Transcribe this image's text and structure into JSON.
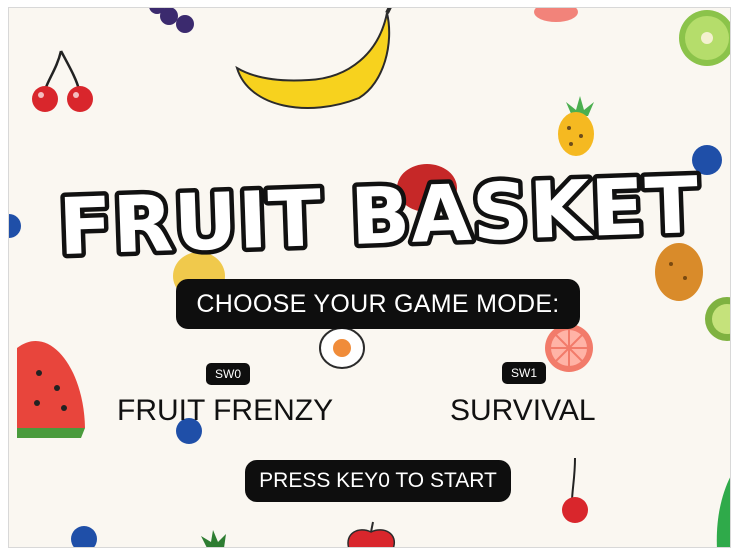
{
  "game": {
    "title": "FRUIT BASKET",
    "prompt": "CHOOSE  YOUR GAME MODE:",
    "modes": [
      {
        "switch": "SW0",
        "label": "FRUIT FRENZY"
      },
      {
        "switch": "SW1",
        "label": "SURVIVAL"
      }
    ],
    "start_hint": "PRESS KEY0 TO START"
  },
  "colors": {
    "background": "#faf7f1",
    "title_fill": "#ffffff",
    "title_outline": "#111111",
    "pill": "#0e0e0e"
  }
}
